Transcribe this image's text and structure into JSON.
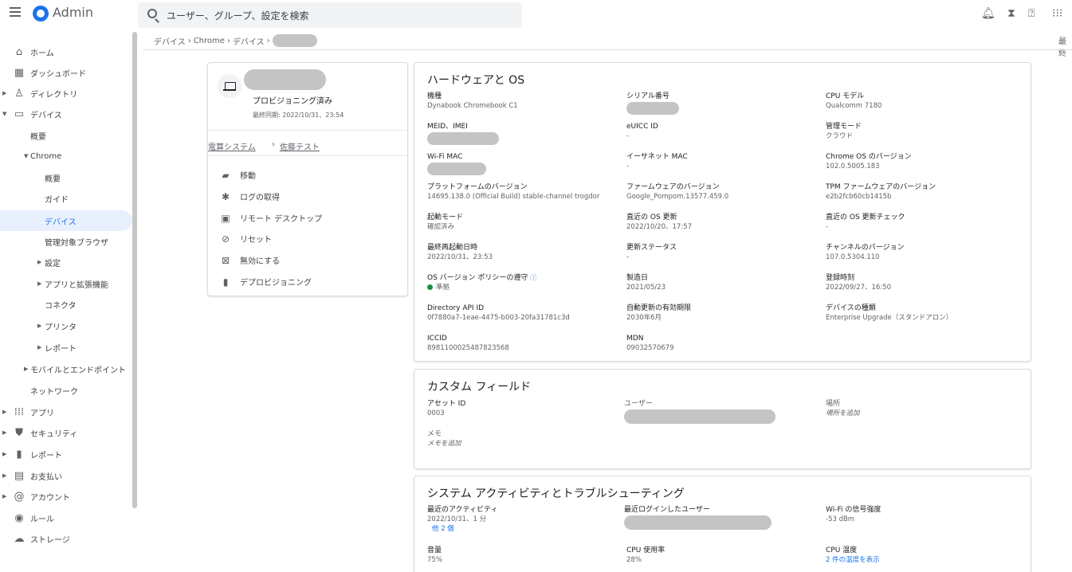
{
  "topbar": {
    "app_title": "Admin",
    "search_placeholder": "ユーザー、グループ、設定を検索",
    "icons": [
      "bell-icon",
      "hourglass-icon",
      "help-icon",
      "apps-grid-icon"
    ]
  },
  "breadcrumb": {
    "items": [
      "デバイス",
      "Chrome",
      "デバイス"
    ],
    "separator": "›",
    "right_text": "最終"
  },
  "sidebar": {
    "items": [
      {
        "label": "ホーム",
        "icon": "home-icon"
      },
      {
        "label": "ダッシュボード",
        "icon": "dashboard-icon"
      },
      {
        "label": "ディレクトリ",
        "icon": "person-icon"
      },
      {
        "label": "デバイス",
        "icon": "devices-icon"
      },
      {
        "label": "概要"
      },
      {
        "label": "Chrome"
      },
      {
        "label": "概要"
      },
      {
        "label": "ガイド"
      },
      {
        "label": "デバイス"
      },
      {
        "label": "管理対象ブラウザ"
      },
      {
        "label": "設定"
      },
      {
        "label": "アプリと拡張機能"
      },
      {
        "label": "コネクタ"
      },
      {
        "label": "プリンタ"
      },
      {
        "label": "レポート"
      },
      {
        "label": "モバイルとエンドポイント"
      },
      {
        "label": "ネットワーク"
      },
      {
        "label": "アプリ",
        "icon": "apps-icon"
      },
      {
        "label": "セキュリティ",
        "icon": "shield-icon"
      },
      {
        "label": "レポート",
        "icon": "bar-chart-icon"
      },
      {
        "label": "お支払い",
        "icon": "billing-icon"
      },
      {
        "label": "アカウント",
        "icon": "at-icon"
      },
      {
        "label": "ルール",
        "icon": "rules-icon"
      },
      {
        "label": "ストレージ",
        "icon": "cloud-icon"
      }
    ]
  },
  "device_card": {
    "status": "プロビジョニング済み",
    "last_sync": "最終同期: 2022/10/31、23:54",
    "org_path": [
      "電算システム",
      "佐藤テスト"
    ],
    "actions": [
      {
        "label": "移動",
        "icon": "move-folder-icon"
      },
      {
        "label": "ログの取得",
        "icon": "bug-icon"
      },
      {
        "label": "リモート デスクトップ",
        "icon": "remote-desktop-icon"
      },
      {
        "label": "リセット",
        "icon": "reset-icon"
      },
      {
        "label": "無効にする",
        "icon": "disable-icon"
      },
      {
        "label": "デプロビジョニング",
        "icon": "trash-icon"
      }
    ]
  },
  "hardware": {
    "title": "ハードウェアと OS",
    "fields": [
      {
        "label": "機種",
        "value": "Dynabook Chromebook C1"
      },
      {
        "label": "シリアル番号",
        "value": ""
      },
      {
        "label": "CPU モデル",
        "value": "Qualcomm 7180"
      },
      {
        "label": "MEID、IMEI",
        "value": ""
      },
      {
        "label": "eUICC ID",
        "value": "-"
      },
      {
        "label": "管理モード",
        "value": "クラウド"
      },
      {
        "label": "Wi-Fi MAC",
        "value": ""
      },
      {
        "label": "イーサネット MAC",
        "value": "-"
      },
      {
        "label": "Chrome OS のバージョン",
        "value": "102.0.5005.183"
      },
      {
        "label": "プラットフォームのバージョン",
        "value": "14695.138.0 (Official Build) stable-channel trogdor"
      },
      {
        "label": "ファームウェアのバージョン",
        "value": "Google_Pompom.13577.459.0"
      },
      {
        "label": "TPM ファームウェアのバージョン",
        "value": "e2b2fcb60cb1415b"
      },
      {
        "label": "起動モード",
        "value": "確認済み"
      },
      {
        "label": "直近の OS 更新",
        "value": "2022/10/20、17:57"
      },
      {
        "label": "直近の OS 更新チェック",
        "value": "-"
      },
      {
        "label": "最終再起動日時",
        "value": "2022/10/31、23:53"
      },
      {
        "label": "更新ステータス",
        "value": "-"
      },
      {
        "label": "チャンネルのバージョン",
        "value": "107.0.5304.110"
      },
      {
        "label": "OS バージョン ポリシーの遵守",
        "value": "準拠"
      },
      {
        "label": "製造日",
        "value": "2021/05/23"
      },
      {
        "label": "登録時刻",
        "value": "2022/09/27、16:50"
      },
      {
        "label": "Directory API ID",
        "value": "0f7880a7-1eae-4475-b003-20fa31781c3d"
      },
      {
        "label": "自動更新の有効期限",
        "value": "2030年6月"
      },
      {
        "label": "デバイスの種類",
        "value": "Enterprise Upgrade（スタンドアロン）"
      },
      {
        "label": "ICCID",
        "value": "8981100025487823568"
      },
      {
        "label": "MDN",
        "value": "09032570679"
      }
    ]
  },
  "custom_fields": {
    "title": "カスタム フィールド",
    "fields": [
      {
        "label": "アセット ID",
        "value": "0003"
      },
      {
        "label": "ユーザー",
        "value": ""
      },
      {
        "label": "場所",
        "value": "場所を追加"
      },
      {
        "label": "メモ",
        "value": "メモを追加"
      }
    ]
  },
  "activity": {
    "title": "システム アクティビティとトラブルシューティング",
    "fields": [
      {
        "label": "最近のアクティビティ",
        "value": "2022/10/31、1 分",
        "extra": "他 2 個"
      },
      {
        "label": "最近ログインしたユーザー",
        "value": ""
      },
      {
        "label": "Wi-Fi の信号強度",
        "value": "-53 dBm"
      },
      {
        "label": "音量",
        "value": "75%"
      },
      {
        "label": "CPU 使用率",
        "value": "28%"
      },
      {
        "label": "CPU 温度",
        "value": "2 件の温度を表示"
      }
    ]
  },
  "colors": {
    "accent": "#1a73e8",
    "active_bg": "#e8f0fe",
    "ok_green": "#1e8e3e"
  }
}
